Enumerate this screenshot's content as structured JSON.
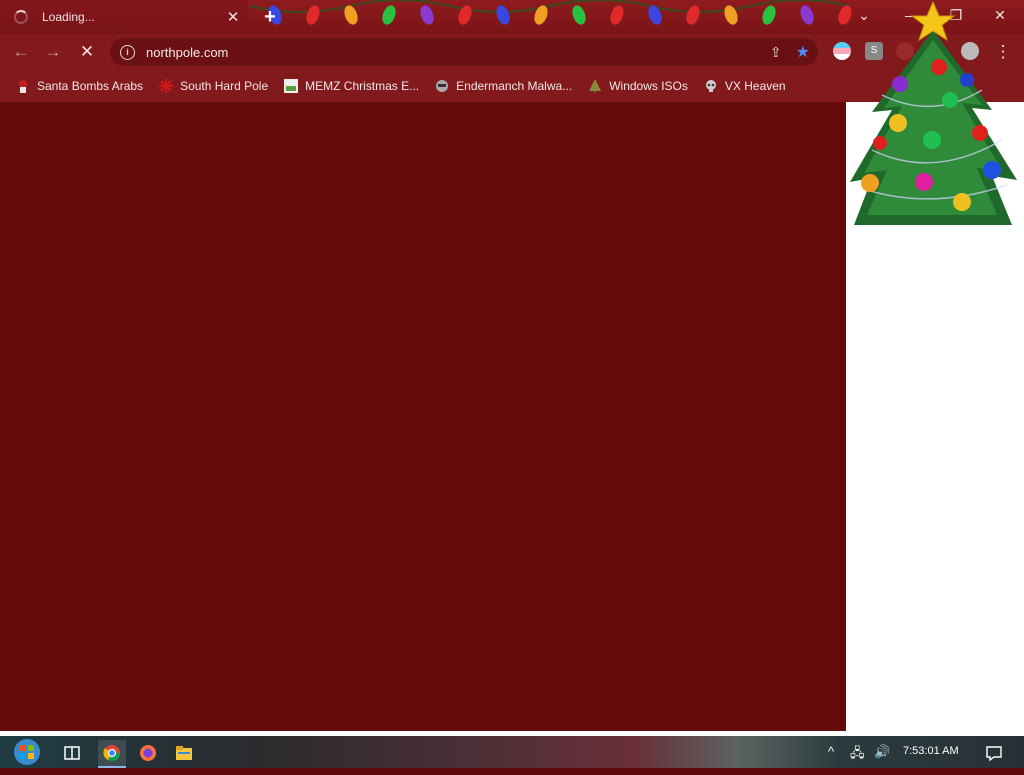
{
  "tab": {
    "title": "Loading...",
    "close": "✕"
  },
  "window_controls": {
    "dropdown": "⌄",
    "minimize": "—",
    "restore": "❐",
    "close": "✕"
  },
  "newtab_label": "+",
  "nav": {
    "back": "←",
    "forward": "→",
    "stop": "✕"
  },
  "omnibox": {
    "url": "northpole.com",
    "share": "⇪",
    "star": "★"
  },
  "extensions": [
    "flag-icon",
    "s-extension-icon",
    "puzzle-icon",
    "profile-icon"
  ],
  "menu": "⋮",
  "bookmarks": [
    {
      "label": "Santa Bombs Arabs",
      "icon": "santa-icon",
      "color": "#c02020"
    },
    {
      "label": "South Hard Pole",
      "icon": "snowflake-icon",
      "color": "#d01818"
    },
    {
      "label": "MEMZ Christmas E...",
      "icon": "image-icon",
      "color": "#5a9e3a"
    },
    {
      "label": "Endermanch Malwa...",
      "icon": "raccoon-icon",
      "color": "#aaaaaa"
    },
    {
      "label": "Windows ISOs",
      "icon": "tree-icon",
      "color": "#8a8a3a"
    },
    {
      "label": "VX Heaven",
      "icon": "skull-icon",
      "color": "#cccccc"
    }
  ],
  "taskbar": {
    "clock": "7:53:01 AM",
    "tray_up": "^",
    "network": "🖧",
    "volume": "🔊"
  },
  "colors": {
    "content_bg": "#640a0a",
    "chrome": "#821a1d"
  }
}
